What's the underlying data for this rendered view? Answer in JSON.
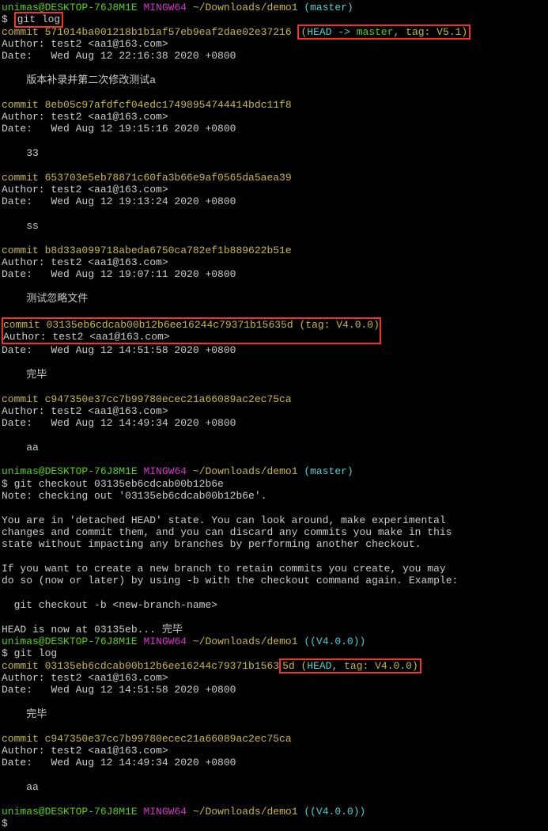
{
  "prompt1": {
    "user": "unimas@DESKTOP-76J8M1E",
    "sys": "MINGW64",
    "path": "~/Downloads/demo1",
    "branch": "(master)",
    "dollar": "$ ",
    "cmd": "git log"
  },
  "commits_top": [
    {
      "hash_pre": "commit 571014ba001218b1b1af57eb9eaf2dae02e37216",
      "ref": {
        "p1": "(",
        "head": "HEAD -> ",
        "master": "master",
        "comma": ", ",
        "tag": "tag: V5.1",
        "p2": ")"
      },
      "author": "Author: test2 <aa1@163.com>",
      "date": "Date:   Wed Aug 12 22:16:38 2020 +0800",
      "msg": "    版本补录并第二次修改测试a"
    },
    {
      "hash_pre": "commit 8eb05c97afdfcf04edc17498954744414bdc11f8",
      "author": "Author: test2 <aa1@163.com>",
      "date": "Date:   Wed Aug 12 19:15:16 2020 +0800",
      "msg": "    33"
    },
    {
      "hash_pre": "commit 653703e5eb78871c60fa3b66e9af0565da5aea39",
      "author": "Author: test2 <aa1@163.com>",
      "date": "Date:   Wed Aug 12 19:13:24 2020 +0800",
      "msg": "    ss"
    },
    {
      "hash_pre": "commit b8d33a099718abeda6750ca782ef1b889622b51e",
      "author": "Author: test2 <aa1@163.com>",
      "date": "Date:   Wed Aug 12 19:07:11 2020 +0800",
      "msg": "    测试忽略文件"
    }
  ],
  "boxed_commit": {
    "hash": "commit 03135eb6cdcab00b12b6ee16244c79371b15635d",
    "ref": {
      "p1": " (",
      "tag": "tag: V4.0.0",
      "p2": ")"
    },
    "author": "Author: test2 <aa1@163.com>",
    "date": "Date:   Wed Aug 12 14:51:58 2020 +0800",
    "msg": "    完毕"
  },
  "commit_after_box": {
    "hash": "commit c947350e37cc7b99780ecec21a66089ac2ec75ca",
    "author": "Author: test2 <aa1@163.com>",
    "date": "Date:   Wed Aug 12 14:49:34 2020 +0800",
    "msg": "    aa"
  },
  "prompt2": {
    "user": "unimas@DESKTOP-76J8M1E",
    "sys": "MINGW64",
    "path": "~/Downloads/demo1",
    "branch": "(master)",
    "cmd": "$ git checkout 03135eb6cdcab00b12b6e"
  },
  "checkout_note": "Note: checking out '03135eb6cdcab00b12b6e'.",
  "checkout_msg": [
    "You are in 'detached HEAD' state. You can look around, make experimental",
    "changes and commit them, and you can discard any commits you make in this",
    "state without impacting any branches by performing another checkout.",
    "",
    "If you want to create a new branch to retain commits you create, you may",
    "do so (now or later) by using -b with the checkout command again. Example:",
    "",
    "  git checkout -b <new-branch-name>",
    "",
    "HEAD is now at 03135eb... 完毕"
  ],
  "prompt3": {
    "user": "unimas@DESKTOP-76J8M1E",
    "sys": "MINGW64",
    "path": "~/Downloads/demo1",
    "branch": "((V4.0.0))",
    "cmd": "$ git log"
  },
  "log2_c1": {
    "hash_pre": "commit 03135eb6cdcab00b12b6ee16244c79371b1563",
    "hash_in": "5d ",
    "ref": {
      "p1": "(",
      "head": "HEAD",
      "comma": ", ",
      "tag": "tag: V4.0.0",
      "p2": ")"
    },
    "author": "Author: test2 <aa1@163.com>",
    "date": "Date:   Wed Aug 12 14:51:58 2020 +0800",
    "msg": "    完毕"
  },
  "log2_c2": {
    "hash": "commit c947350e37cc7b99780ecec21a66089ac2ec75ca",
    "author": "Author: test2 <aa1@163.com>",
    "date": "Date:   Wed Aug 12 14:49:34 2020 +0800",
    "msg": "    aa"
  },
  "prompt4": {
    "user": "unimas@DESKTOP-76J8M1E",
    "sys": "MINGW64",
    "path": "~/Downloads/demo1",
    "branch": "((V4.0.0))",
    "cmd": "$"
  }
}
